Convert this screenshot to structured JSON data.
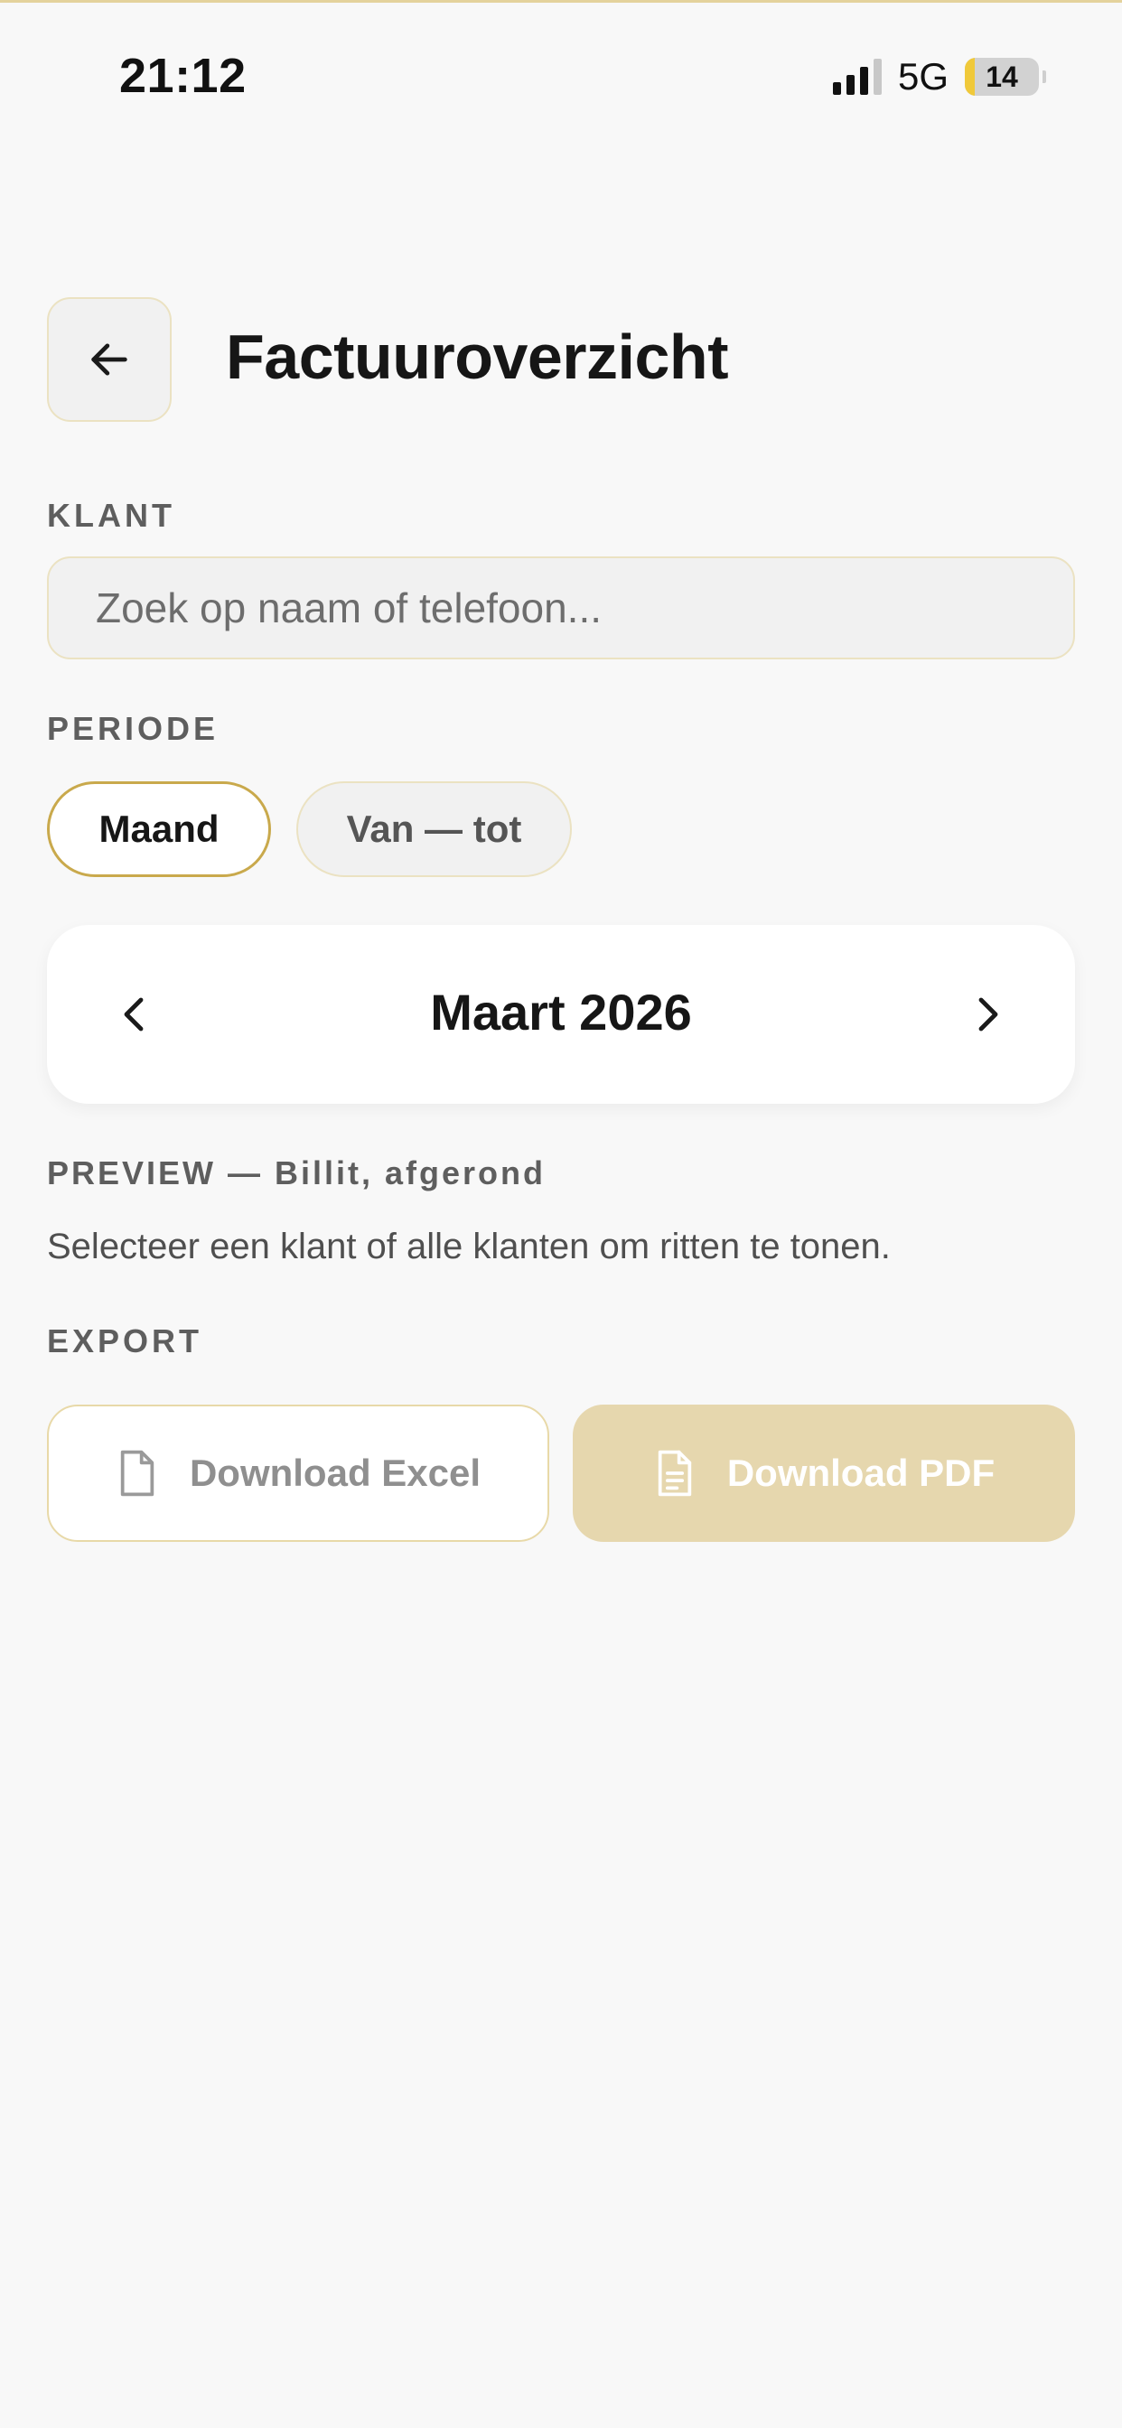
{
  "status_bar": {
    "time": "21:12",
    "network": "5G",
    "battery_level": "14",
    "battery_fraction": 0.14,
    "signal_bars_active": 3,
    "signal_bars_total": 4
  },
  "header": {
    "title": "Factuuroverzicht",
    "back_icon": "arrow-left-icon"
  },
  "client_section": {
    "label": "KLANT",
    "search_placeholder": "Zoek op naam of telefoon...",
    "search_value": ""
  },
  "period_section": {
    "label": "PERIODE",
    "options": [
      {
        "label": "Maand",
        "active": true
      },
      {
        "label": "Van — tot",
        "active": false
      }
    ]
  },
  "month_selector": {
    "label": "Maart 2026",
    "prev_icon": "chevron-left-icon",
    "next_icon": "chevron-right-icon"
  },
  "preview_section": {
    "label": "PREVIEW — Billit, afgerond",
    "message": "Selecteer een klant of alle klanten om ritten te tonen."
  },
  "export_section": {
    "label": "EXPORT",
    "excel_label": "Download Excel",
    "excel_icon": "file-icon",
    "pdf_label": "Download PDF",
    "pdf_icon": "file-text-icon"
  },
  "colors": {
    "accent": "#c9a94c",
    "border": "#ebe2c2",
    "pdf_button_bg": "#e6d7ae",
    "battery_fill": "#f0c93a",
    "background": "#f8f8f8"
  }
}
